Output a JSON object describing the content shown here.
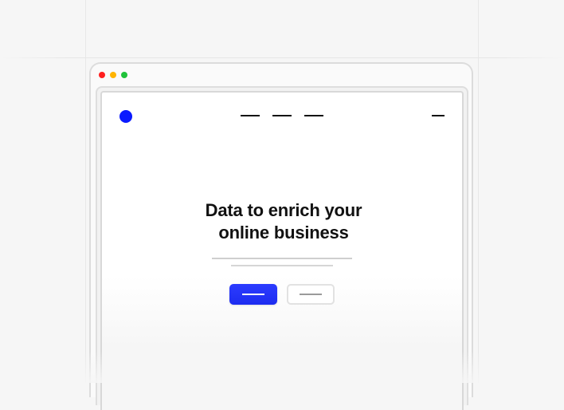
{
  "window": {
    "dots": [
      {
        "name": "close",
        "color": "#ff1f1f"
      },
      {
        "name": "minimize",
        "color": "#ffb400"
      },
      {
        "name": "maximize",
        "color": "#1fc23a"
      }
    ]
  },
  "site": {
    "logo_color": "#0a1aff",
    "nav_item_count": 3
  },
  "hero": {
    "title_line_1": "Data to enrich your",
    "title_line_2": "online business"
  },
  "buttons": {
    "primary_color": "#2233ff"
  }
}
